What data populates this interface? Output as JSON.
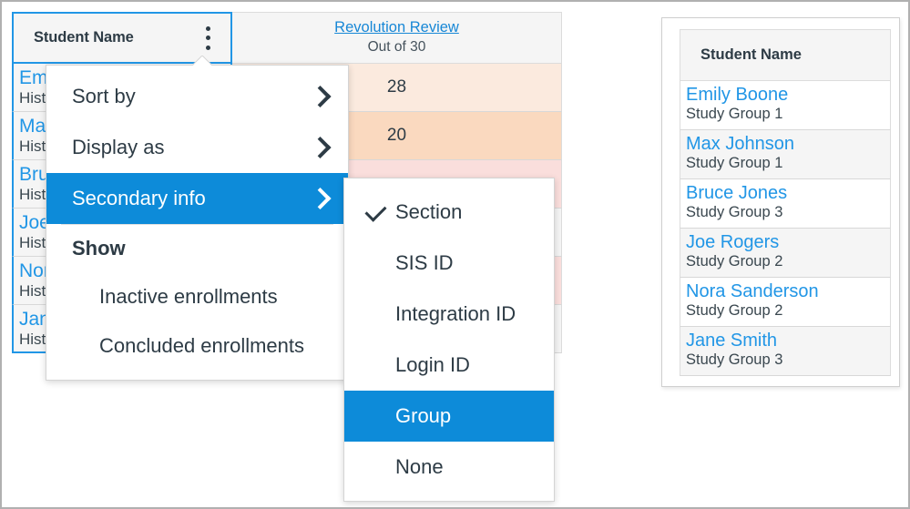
{
  "gradebook": {
    "name_column": {
      "header_label": "Student Name",
      "kebab_icon": "kebab-menu-icon"
    },
    "assignment_column": {
      "title": "Revolution Review",
      "points": "Out of 30"
    },
    "rows": [
      {
        "name": "Emily Boone",
        "secondary": "History",
        "grade": "28",
        "grade_bg": "#fbeade"
      },
      {
        "name": "Max Johnson",
        "secondary": "History",
        "grade": "20",
        "grade_bg": "#fad9bf"
      },
      {
        "name": "Bruce Jones",
        "secondary": "History",
        "grade": "",
        "grade_bg": "#fadedc"
      },
      {
        "name": "Joe Rogers",
        "secondary": "History",
        "grade": "",
        "grade_bg": "#f4f4f4"
      },
      {
        "name": "Nora Sanderson",
        "secondary": "History",
        "grade": "",
        "grade_bg": "#fadedc"
      },
      {
        "name": "Jane Smith",
        "secondary": "History",
        "grade": "",
        "grade_bg": "#f4f4f4"
      }
    ]
  },
  "menu": {
    "items": [
      {
        "label": "Sort by",
        "has_submenu": true,
        "selected": false
      },
      {
        "label": "Display as",
        "has_submenu": true,
        "selected": false
      },
      {
        "label": "Secondary info",
        "has_submenu": true,
        "selected": true
      }
    ],
    "show_group_label": "Show",
    "show_items": [
      {
        "label": "Inactive enrollments"
      },
      {
        "label": "Concluded enrollments"
      }
    ]
  },
  "submenu": {
    "items": [
      {
        "label": "Section",
        "checked": true,
        "selected": false
      },
      {
        "label": "SIS ID",
        "checked": false,
        "selected": false
      },
      {
        "label": "Integration ID",
        "checked": false,
        "selected": false
      },
      {
        "label": "Login ID",
        "checked": false,
        "selected": false
      },
      {
        "label": "Group",
        "checked": false,
        "selected": true
      },
      {
        "label": "None",
        "checked": false,
        "selected": false
      }
    ]
  },
  "preview_panel": {
    "header_label": "Student Name",
    "rows": [
      {
        "name": "Emily Boone",
        "secondary": "Study Group 1"
      },
      {
        "name": "Max Johnson",
        "secondary": "Study Group 1"
      },
      {
        "name": "Bruce Jones",
        "secondary": "Study Group 3"
      },
      {
        "name": "Joe Rogers",
        "secondary": "Study Group 2"
      },
      {
        "name": "Nora Sanderson",
        "secondary": "Study Group 2"
      },
      {
        "name": "Jane Smith",
        "secondary": "Study Group 3"
      }
    ]
  },
  "colors": {
    "accent_blue": "#0d8bd9",
    "link_blue": "#2196e6",
    "focus_border": "#2196e6",
    "header_bg": "#f5f5f5",
    "text": "#2d3b45"
  }
}
